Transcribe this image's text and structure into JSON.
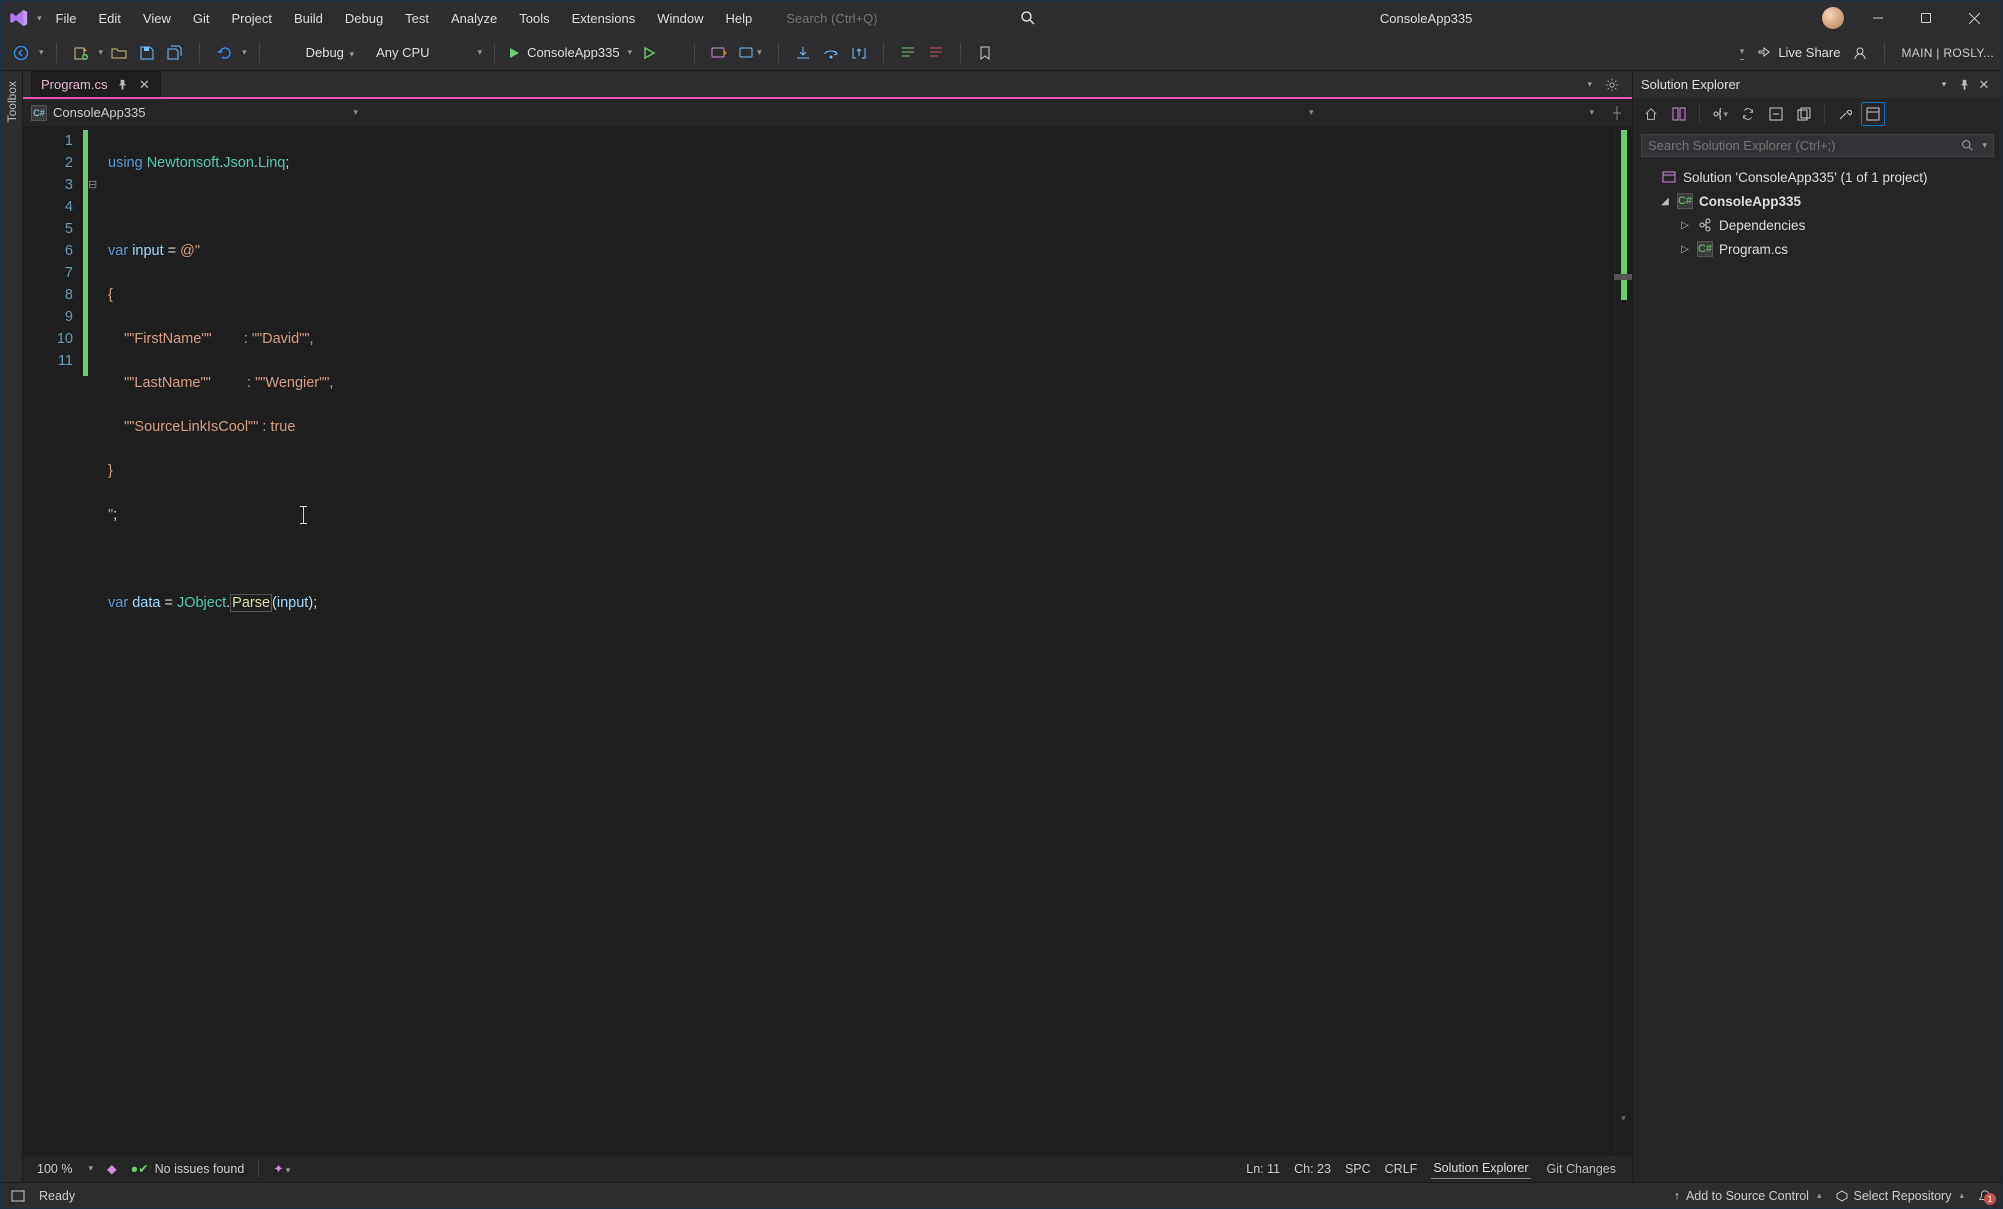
{
  "app": {
    "name": "ConsoleApp335"
  },
  "menu": {
    "file": "File",
    "edit": "Edit",
    "view": "View",
    "git": "Git",
    "project": "Project",
    "build": "Build",
    "debug": "Debug",
    "test": "Test",
    "analyze": "Analyze",
    "tools": "Tools",
    "extensions": "Extensions",
    "window": "Window",
    "help": "Help"
  },
  "search": {
    "placeholder": "Search (Ctrl+Q)"
  },
  "toolbar": {
    "config": "Debug",
    "platform": "Any CPU",
    "run_target": "ConsoleApp335",
    "live_share": "Live Share",
    "branch": "MAIN | ROSLY..."
  },
  "left_rail": {
    "toolbox": "Toolbox"
  },
  "tabs": {
    "active": "Program.cs"
  },
  "nav": {
    "project": "ConsoleApp335"
  },
  "code": {
    "lines": [
      "1",
      "2",
      "3",
      "4",
      "5",
      "6",
      "7",
      "8",
      "9",
      "10",
      "11"
    ],
    "l1_using": "using",
    "l1_ns1": "Newtonsoft",
    "l1_ns2": "Json",
    "l1_ns3": "Linq",
    "l3_var": "var",
    "l3_id": "input",
    "l3_str": "@\"",
    "l4_str": "{",
    "l5_str": "    \"\"FirstName\"\"        : \"\"David\"\",",
    "l6_str": "    \"\"LastName\"\"         : \"\"Wengier\"\",",
    "l7a": "    \"\"SourceLinkIsCool\"\" : ",
    "l7b": "true",
    "l8_str": "}",
    "l9_str": "\"",
    "l11_var": "var",
    "l11_id": "data",
    "l11_type": "JObject",
    "l11_method": "Parse",
    "l11_arg": "input"
  },
  "edfoot": {
    "zoom": "100 %",
    "issues": "No issues found",
    "ln": "Ln: 11",
    "ch": "Ch: 23",
    "spc": "SPC",
    "eol": "CRLF",
    "panel_active": "Solution Explorer",
    "panel_other": "Git Changes"
  },
  "solexp": {
    "title": "Solution Explorer",
    "search_placeholder": "Search Solution Explorer (Ctrl+;)",
    "solution": "Solution 'ConsoleApp335' (1 of 1 project)",
    "project": "ConsoleApp335",
    "deps": "Dependencies",
    "program": "Program.cs"
  },
  "status": {
    "ready": "Ready",
    "add_src": "Add to Source Control",
    "select_repo": "Select Repository",
    "notif_count": "1"
  }
}
